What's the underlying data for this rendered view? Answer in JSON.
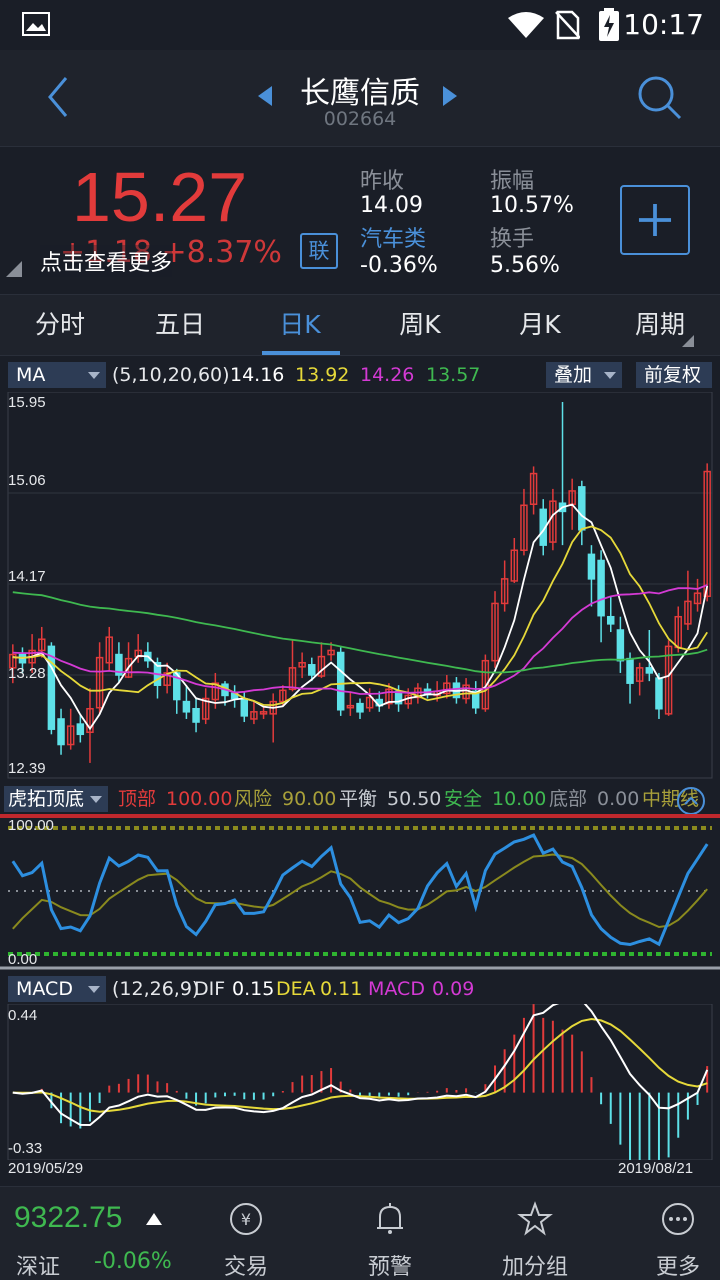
{
  "status": {
    "time": "10:17"
  },
  "header": {
    "stock_name": "长鹰信质",
    "stock_code": "002664"
  },
  "quote": {
    "price": "15.27",
    "change": "+1.18 +8.37%",
    "hint": "点击查看更多",
    "lian": "联",
    "prev_close_label": "昨收",
    "prev_close": "14.09",
    "amplitude_label": "振幅",
    "amplitude": "10.57%",
    "sector_label": "汽车类",
    "sector_change": "-0.36%",
    "turnover_label": "换手",
    "turnover": "5.56%"
  },
  "tabs": [
    "分时",
    "五日",
    "日K",
    "周K",
    "月K",
    "周期"
  ],
  "active_tab": "日K",
  "ma_row": {
    "selector": "MA",
    "params": "(5,10,20,60)",
    "ma5": "14.16",
    "ma10": "13.92",
    "ma20": "14.26",
    "ma60": "13.57",
    "overlay": "叠加",
    "adjust": "前复权"
  },
  "kline_axis": {
    "top": "15.95",
    "l2": "15.06",
    "l3": "14.17",
    "l4": "13.28",
    "bottom": "12.39"
  },
  "hutuo_row": {
    "selector": "虎拓顶底",
    "top_label": "顶部",
    "top_val": "100.00",
    "risk_label": "风险",
    "risk_val": "90.00",
    "balance_label": "平衡",
    "balance_val": "50.50",
    "safe_label": "安全",
    "safe_val": "10.00",
    "bottom_label": "底部",
    "bottom_val": "0.00",
    "mid_label": "中期线"
  },
  "hutuo_axis": {
    "top": "100.00",
    "bottom": "0.00"
  },
  "macd_row": {
    "selector": "MACD",
    "params": "(12,26,9)",
    "dif_label": "DIF",
    "dif": "0.15",
    "dea_label": "DEA",
    "dea": "0.11",
    "macd_label": "MACD",
    "macd": "0.09"
  },
  "macd_axis": {
    "top": "0.44",
    "bottom": "-0.33"
  },
  "dates": {
    "start": "2019/05/29",
    "end": "2019/08/21"
  },
  "footer": {
    "index_value": "9322.75",
    "index_name": "深证",
    "index_change": "-0.06%",
    "nav": [
      "交易",
      "预警",
      "加分组",
      "更多"
    ]
  },
  "colors": {
    "up": "#e23b3b",
    "down": "#5ee1e8",
    "accent": "#4a90d9",
    "ma5": "#ffffff",
    "ma10": "#e6d93a",
    "ma20": "#d43ad4",
    "ma60": "#3fb950"
  },
  "chart_data": {
    "type": "candlestick",
    "title": "",
    "ylim": [
      12.39,
      15.95
    ],
    "candles": [
      [
        13.35,
        13.48,
        13.58,
        13.2
      ],
      [
        13.48,
        13.4,
        13.55,
        13.3
      ],
      [
        13.4,
        13.52,
        13.68,
        13.3
      ],
      [
        13.52,
        13.63,
        13.75,
        13.45
      ],
      [
        13.56,
        12.75,
        13.6,
        12.7
      ],
      [
        12.85,
        12.6,
        12.95,
        12.5
      ],
      [
        12.6,
        12.78,
        12.95,
        12.55
      ],
      [
        12.8,
        12.7,
        12.9,
        12.62
      ],
      [
        12.72,
        12.95,
        13.15,
        12.42
      ],
      [
        12.96,
        13.45,
        13.6,
        12.9
      ],
      [
        13.4,
        13.65,
        13.75,
        13.32
      ],
      [
        13.48,
        13.28,
        13.6,
        13.2
      ],
      [
        13.26,
        13.44,
        13.6,
        13.25
      ],
      [
        13.46,
        13.52,
        13.68,
        13.4
      ],
      [
        13.5,
        13.42,
        13.6,
        13.35
      ],
      [
        13.4,
        13.18,
        13.45,
        13.05
      ],
      [
        13.18,
        13.3,
        13.4,
        13.1
      ],
      [
        13.3,
        13.04,
        13.34,
        12.9
      ],
      [
        13.02,
        12.92,
        13.18,
        12.85
      ],
      [
        12.95,
        12.82,
        13.05,
        12.72
      ],
      [
        12.85,
        13.05,
        13.15,
        12.8
      ],
      [
        13.04,
        13.2,
        13.3,
        12.95
      ],
      [
        13.19,
        13.08,
        13.22,
        12.98
      ],
      [
        13.1,
        13.05,
        13.18,
        12.96
      ],
      [
        13.04,
        12.88,
        13.12,
        12.82
      ],
      [
        12.85,
        12.92,
        13.02,
        12.8
      ],
      [
        12.9,
        12.92,
        12.98,
        12.85
      ],
      [
        12.9,
        13.02,
        13.1,
        12.62
      ],
      [
        13.02,
        13.13,
        13.18,
        12.98
      ],
      [
        13.14,
        13.35,
        13.62,
        13.12
      ],
      [
        13.36,
        13.4,
        13.5,
        13.25
      ],
      [
        13.38,
        13.28,
        13.45,
        13.22
      ],
      [
        13.27,
        13.46,
        13.6,
        13.25
      ],
      [
        13.48,
        13.52,
        13.6,
        13.42
      ],
      [
        13.5,
        12.94,
        13.55,
        12.88
      ],
      [
        12.96,
        12.98,
        13.12,
        12.88
      ],
      [
        13.0,
        12.92,
        13.05,
        12.85
      ],
      [
        12.96,
        13.06,
        13.15,
        12.92
      ],
      [
        13.04,
        12.98,
        13.12,
        12.92
      ],
      [
        13.0,
        13.14,
        13.2,
        12.95
      ],
      [
        13.12,
        13.0,
        13.18,
        12.92
      ],
      [
        13.0,
        13.08,
        13.15,
        12.95
      ],
      [
        13.06,
        13.15,
        13.2,
        13.0
      ],
      [
        13.14,
        13.09,
        13.2,
        13.05
      ],
      [
        13.08,
        13.12,
        13.22,
        13.02
      ],
      [
        13.1,
        13.2,
        13.28,
        13.05
      ],
      [
        13.2,
        13.06,
        13.26,
        13.0
      ],
      [
        13.05,
        13.18,
        13.25,
        13.0
      ],
      [
        13.12,
        12.96,
        13.22,
        12.9
      ],
      [
        12.95,
        13.42,
        13.48,
        12.92
      ],
      [
        13.42,
        13.98,
        14.1,
        13.35
      ],
      [
        13.98,
        14.22,
        14.4,
        13.9
      ],
      [
        14.2,
        14.5,
        14.62,
        14.18
      ],
      [
        14.5,
        14.94,
        15.1,
        14.45
      ],
      [
        14.95,
        15.25,
        15.32,
        14.85
      ],
      [
        14.9,
        14.55,
        15.0,
        14.45
      ],
      [
        14.58,
        14.98,
        15.1,
        14.5
      ],
      [
        14.96,
        14.88,
        15.95,
        14.55
      ],
      [
        14.95,
        15.08,
        15.2,
        14.7
      ],
      [
        15.12,
        14.7,
        15.18,
        14.55
      ],
      [
        14.46,
        14.22,
        14.55,
        13.95
      ],
      [
        14.4,
        13.86,
        14.5,
        13.6
      ],
      [
        13.85,
        13.78,
        14.05,
        13.7
      ],
      [
        13.72,
        13.42,
        13.85,
        13.3
      ],
      [
        13.44,
        13.2,
        13.5,
        13.0
      ],
      [
        13.22,
        13.35,
        13.4,
        13.08
      ],
      [
        13.35,
        13.3,
        13.72,
        13.22
      ],
      [
        13.25,
        12.95,
        13.3,
        12.85
      ],
      [
        12.9,
        13.56,
        13.62,
        12.88
      ],
      [
        13.55,
        13.85,
        13.95,
        13.5
      ],
      [
        13.78,
        14.0,
        14.3,
        13.72
      ],
      [
        13.98,
        14.08,
        14.22,
        13.9
      ],
      [
        14.05,
        15.27,
        15.35,
        14.0
      ]
    ]
  }
}
